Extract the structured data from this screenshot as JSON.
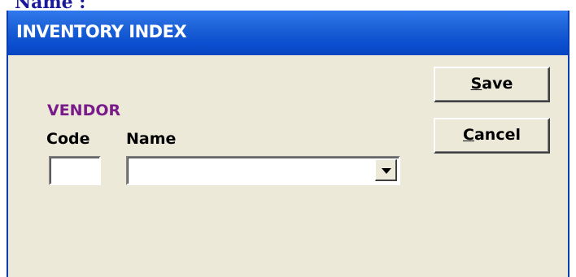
{
  "top_fragment": "Name :",
  "window": {
    "title": "INVENTORY INDEX"
  },
  "form": {
    "section_label": "VENDOR",
    "code_label": "Code",
    "name_label": "Name",
    "code_value": "",
    "name_value": ""
  },
  "buttons": {
    "save": {
      "accel": "S",
      "rest": "ave"
    },
    "cancel": {
      "accel": "C",
      "rest": "ancel"
    }
  },
  "icons": {
    "dropdown": "chevron-down-icon"
  },
  "colors": {
    "titlebar": "#0b4ecf",
    "section_label": "#7a1b8a",
    "dialog_bg": "#ece9d8"
  }
}
